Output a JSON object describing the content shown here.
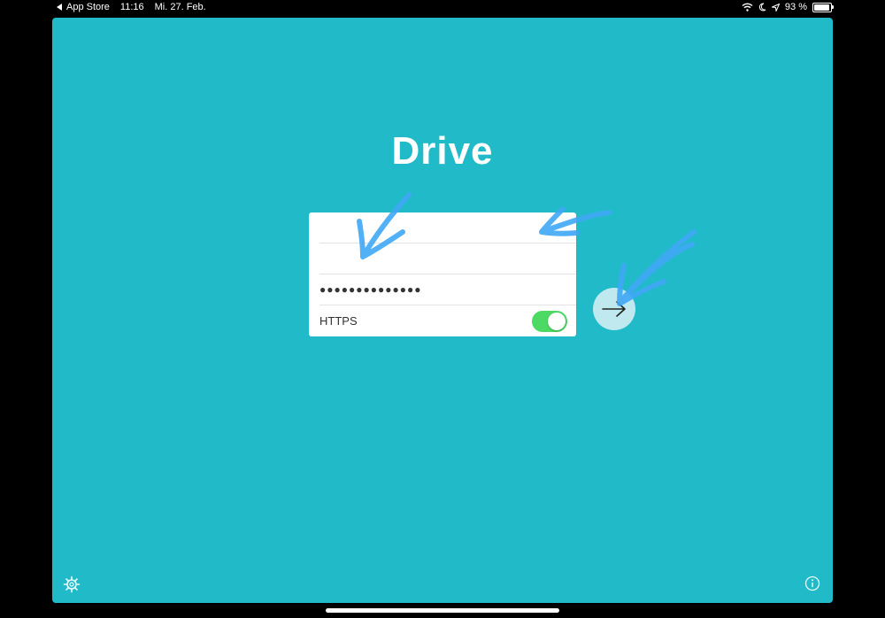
{
  "status_bar": {
    "back_app": "App Store",
    "time": "11:16",
    "date": "Mi. 27. Feb.",
    "battery": "93 %",
    "battery_level": 0.93
  },
  "app": {
    "title": "Drive",
    "accent_color": "#21bac8"
  },
  "form": {
    "host_value": "",
    "username_value": "",
    "password_masked": "●●●●●●●●●●●●●●",
    "https_label": "HTTPS",
    "https_enabled": true
  },
  "icons": {
    "go": "arrow-right-icon",
    "settings": "gear-icon",
    "info": "info-icon",
    "wifi": "wifi-icon",
    "moon": "moon-icon",
    "location": "location-icon"
  }
}
